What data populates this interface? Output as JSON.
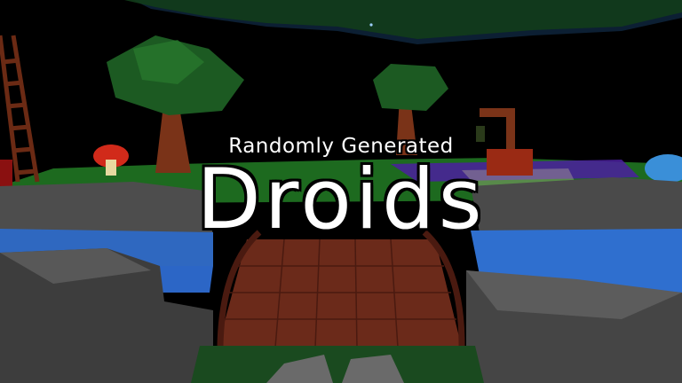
{
  "title": {
    "subtitle": "Randomly Generated",
    "main": "Droids"
  },
  "colors": {
    "sky": "#000000",
    "grass": "#1f6b22",
    "water": "#2f6fcf",
    "rock": "#5a5a5a",
    "bridge": "#6b2a1a",
    "text": "#ffffff"
  }
}
